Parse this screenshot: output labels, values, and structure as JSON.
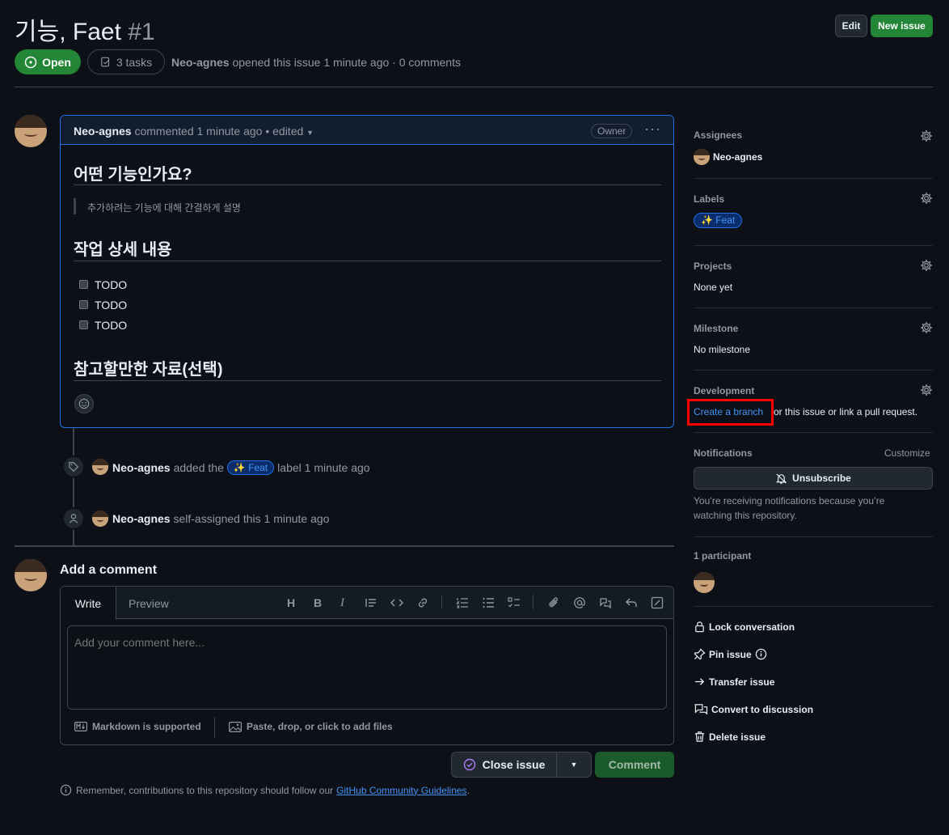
{
  "issue": {
    "title": "기능, Faet",
    "number": "#1",
    "state": "Open",
    "tasks": "3 tasks",
    "author": "Neo-agnes",
    "meta": "opened this issue 1 minute ago · 0 comments"
  },
  "header": {
    "edit_label": "Edit",
    "new_issue_label": "New issue"
  },
  "comment": {
    "author": "Neo-agnes",
    "meta": "commented 1 minute ago • edited",
    "badge": "Owner",
    "h1": "어떤 기능인가요?",
    "quote": "추가하려는 기능에 대해 간결하게 설명",
    "h2": "작업 상세 내용",
    "todos": [
      "TODO",
      "TODO",
      "TODO"
    ],
    "h3": "참고할만한 자료(선택)"
  },
  "timeline": [
    {
      "author": "Neo-agnes",
      "pre": "added the",
      "label": "✨ Feat",
      "post": "label 1 minute ago"
    },
    {
      "author": "Neo-agnes",
      "text": "self-assigned this 1 minute ago"
    }
  ],
  "add_comment": {
    "heading": "Add a comment",
    "tab_write": "Write",
    "tab_preview": "Preview",
    "placeholder": "Add your comment here...",
    "markdown": "Markdown is supported",
    "files": "Paste, drop, or click to add files",
    "close_label": "Close issue",
    "comment_label": "Comment",
    "note_pre": "Remember, contributions to this repository should follow our",
    "note_link": "GitHub Community Guidelines",
    "note_post": "."
  },
  "sidebar": {
    "assignees_h": "Assignees",
    "assignee": "Neo-agnes",
    "labels_h": "Labels",
    "label": "✨ Feat",
    "projects_h": "Projects",
    "projects_v": "None yet",
    "milestone_h": "Milestone",
    "milestone_v": "No milestone",
    "development_h": "Development",
    "create_branch": "Create a branch",
    "dev_rest": "or this issue or link a pull request.",
    "notifications_h": "Notifications",
    "customize": "Customize",
    "unsubscribe": "Unsubscribe",
    "notify_text": "You’re receiving notifications because you’re watching this repository.",
    "participants_h": "1 participant",
    "lock": "Lock conversation",
    "pin": "Pin issue",
    "transfer": "Transfer issue",
    "convert": "Convert to discussion",
    "delete": "Delete issue"
  },
  "colors": {
    "green": "#238636",
    "accent": "#4493f8",
    "highlight": "#ff0000"
  }
}
